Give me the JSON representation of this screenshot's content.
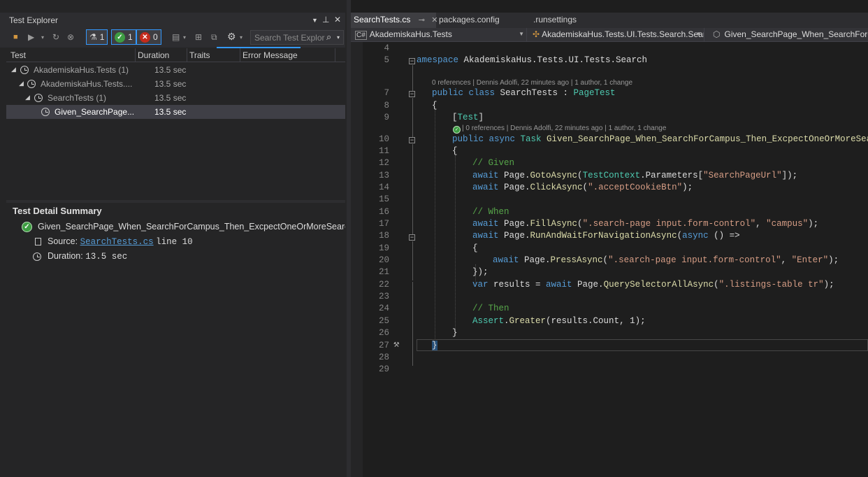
{
  "test_explorer": {
    "title": "Test Explorer",
    "toolbar": {
      "total_count": "1",
      "passed_count": "1",
      "failed_count": "0",
      "search_placeholder": "Search Test Explor"
    },
    "columns": [
      "Test",
      "Duration",
      "Traits",
      "Error Message"
    ],
    "rows": [
      {
        "name": "AkademiskaHus.Tests (1)",
        "duration": "13.5 sec"
      },
      {
        "name": "AkademiskaHus.Tests....",
        "duration": "13.5 sec"
      },
      {
        "name": "SearchTests (1)",
        "duration": "13.5 sec"
      },
      {
        "name": "Given_SearchPage...",
        "duration": "13.5 sec"
      }
    ],
    "detail": {
      "title": "Test Detail Summary",
      "test_name": "Given_SearchPage_When_SearchForCampus_Then_ExcpectOneOrMoreSearch",
      "source_label": "Source:",
      "source_file": "SearchTests.cs",
      "source_line": "line 10",
      "duration_label": "Duration:",
      "duration_value": "13.5 sec"
    }
  },
  "editor": {
    "tabs": [
      {
        "label": "SearchTests.cs",
        "pin": "⊸",
        "close": "✕"
      },
      {
        "label": "packages.config"
      },
      {
        "label": ".runsettings"
      }
    ],
    "nav": {
      "project": "AkademiskaHus.Tests",
      "project_badge": "C#",
      "class": "AkademiskaHus.Tests.UI.Tests.Search.Sear",
      "member": "Given_SearchPage_When_SearchForCam"
    },
    "lens": {
      "class_refs": "0 references | Dennis Adolfi, 22 minutes ago | 1 author, 1 change",
      "method_refs": "| 0 references | Dennis Adolfi, 22 minutes ago | 1 author, 1 change"
    },
    "line_numbers": [
      "4",
      "5",
      "7",
      "8",
      "9",
      "10",
      "11",
      "12",
      "13",
      "14",
      "15",
      "16",
      "17",
      "18",
      "19",
      "20",
      "21",
      "22",
      "23",
      "24",
      "25",
      "26",
      "27",
      "28",
      "29"
    ],
    "code": {
      "l5_kw": "amespace",
      "l5_ns": " AkademiskaHus.Tests.UI.Tests.Search",
      "l7_kw": "public class",
      "l7_name": " SearchTests : ",
      "l7_base": "PageTest",
      "l8": "{",
      "l9_open": "[",
      "l9_attr": "Test",
      "l9_close": "]",
      "l10_kw": "public async",
      "l10_type": " Task ",
      "l10_name": "Given_SearchPage_When_SearchForCampus_Then_ExcpectOneOrMoreSearch",
      "l11": "{",
      "l12": "// Given",
      "l13_kw": "await",
      "l13_a": " Page.",
      "l13_m": "GotoAsync",
      "l13_b": "(",
      "l13_t": "TestContext",
      "l13_c": ".Parameters[",
      "l13_s": "\"SearchPageUrl\"",
      "l13_d": "]);",
      "l14_kw": "await",
      "l14_a": " Page.",
      "l14_m": "ClickAsync",
      "l14_b": "(",
      "l14_s": "\".acceptCookieBtn\"",
      "l14_c": ");",
      "l16": "// When",
      "l17_kw": "await",
      "l17_a": " Page.",
      "l17_m": "FillAsync",
      "l17_b": "(",
      "l17_s1": "\".search-page input.form-control\"",
      "l17_c": ", ",
      "l17_s2": "\"campus\"",
      "l17_d": ");",
      "l18_kw": "await",
      "l18_a": " Page.",
      "l18_m": "RunAndWaitForNavigationAsync",
      "l18_b": "(",
      "l18_kw2": "async",
      "l18_c": " () =>",
      "l19": "{",
      "l20_kw": "await",
      "l20_a": " Page.",
      "l20_m": "PressAsync",
      "l20_b": "(",
      "l20_s1": "\".search-page input.form-control\"",
      "l20_c": ", ",
      "l20_s2": "\"Enter\"",
      "l20_d": ");",
      "l21": "});",
      "l22_kw": "var",
      "l22_a": " results = ",
      "l22_kw2": "await",
      "l22_b": " Page.",
      "l22_m": "QuerySelectorAllAsync",
      "l22_c": "(",
      "l22_s": "\".listings-table tr\"",
      "l22_d": ");",
      "l24": "// Then",
      "l25_t": "Assert",
      "l25_a": ".",
      "l25_m": "Greater",
      "l25_b": "(results.Count, 1);",
      "l26": "}",
      "l27": "}"
    }
  },
  "colors": {
    "accent": "#3399ff",
    "pass": "#3e9d43",
    "fail": "#c42b1c",
    "keyword": "#569cd6",
    "type": "#4ec9b0",
    "string": "#d69d85",
    "comment": "#57a64a"
  }
}
